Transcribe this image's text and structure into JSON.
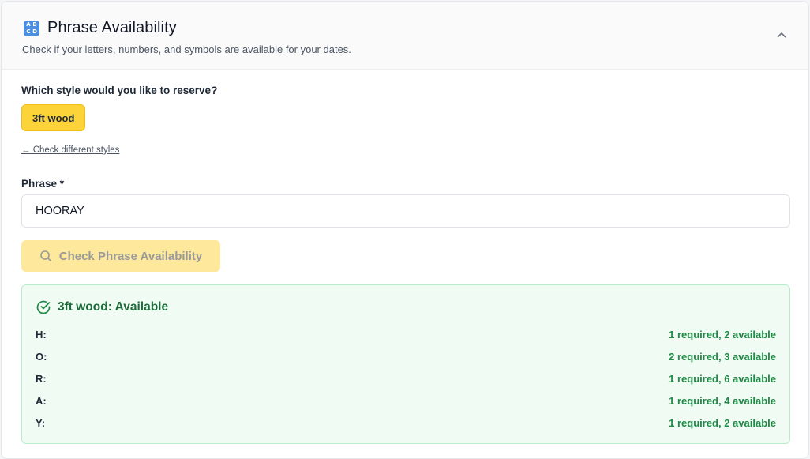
{
  "header": {
    "icon": "abcd-letters-icon",
    "icon_letters": [
      "A",
      "B",
      "C",
      "D"
    ],
    "title": "Phrase Availability",
    "subtitle": "Check if your letters, numbers, and symbols are available for your dates."
  },
  "style_section": {
    "question": "Which style would you like to reserve?",
    "selected_style": "3ft wood",
    "change_link": "← Check different styles"
  },
  "phrase": {
    "label": "Phrase *",
    "value": "HOORAY"
  },
  "check_button": {
    "label": "Check Phrase Availability",
    "icon": "search-icon"
  },
  "result": {
    "title": "3ft wood: Available",
    "icon": "check-circle-icon",
    "rows": [
      {
        "letter": "H:",
        "status": "1 required, 2 available"
      },
      {
        "letter": "O:",
        "status": "2 required, 3 available"
      },
      {
        "letter": "R:",
        "status": "1 required, 6 available"
      },
      {
        "letter": "A:",
        "status": "1 required, 4 available"
      },
      {
        "letter": "Y:",
        "status": "1 required, 2 available"
      }
    ]
  },
  "colors": {
    "accent_yellow": "#fdd33a",
    "button_disabled_yellow": "#fde89b",
    "success_green": "#1f8a46",
    "success_bg": "#effbf3",
    "success_border": "#b8ebc9",
    "icon_blue": "#4a8fe0"
  }
}
